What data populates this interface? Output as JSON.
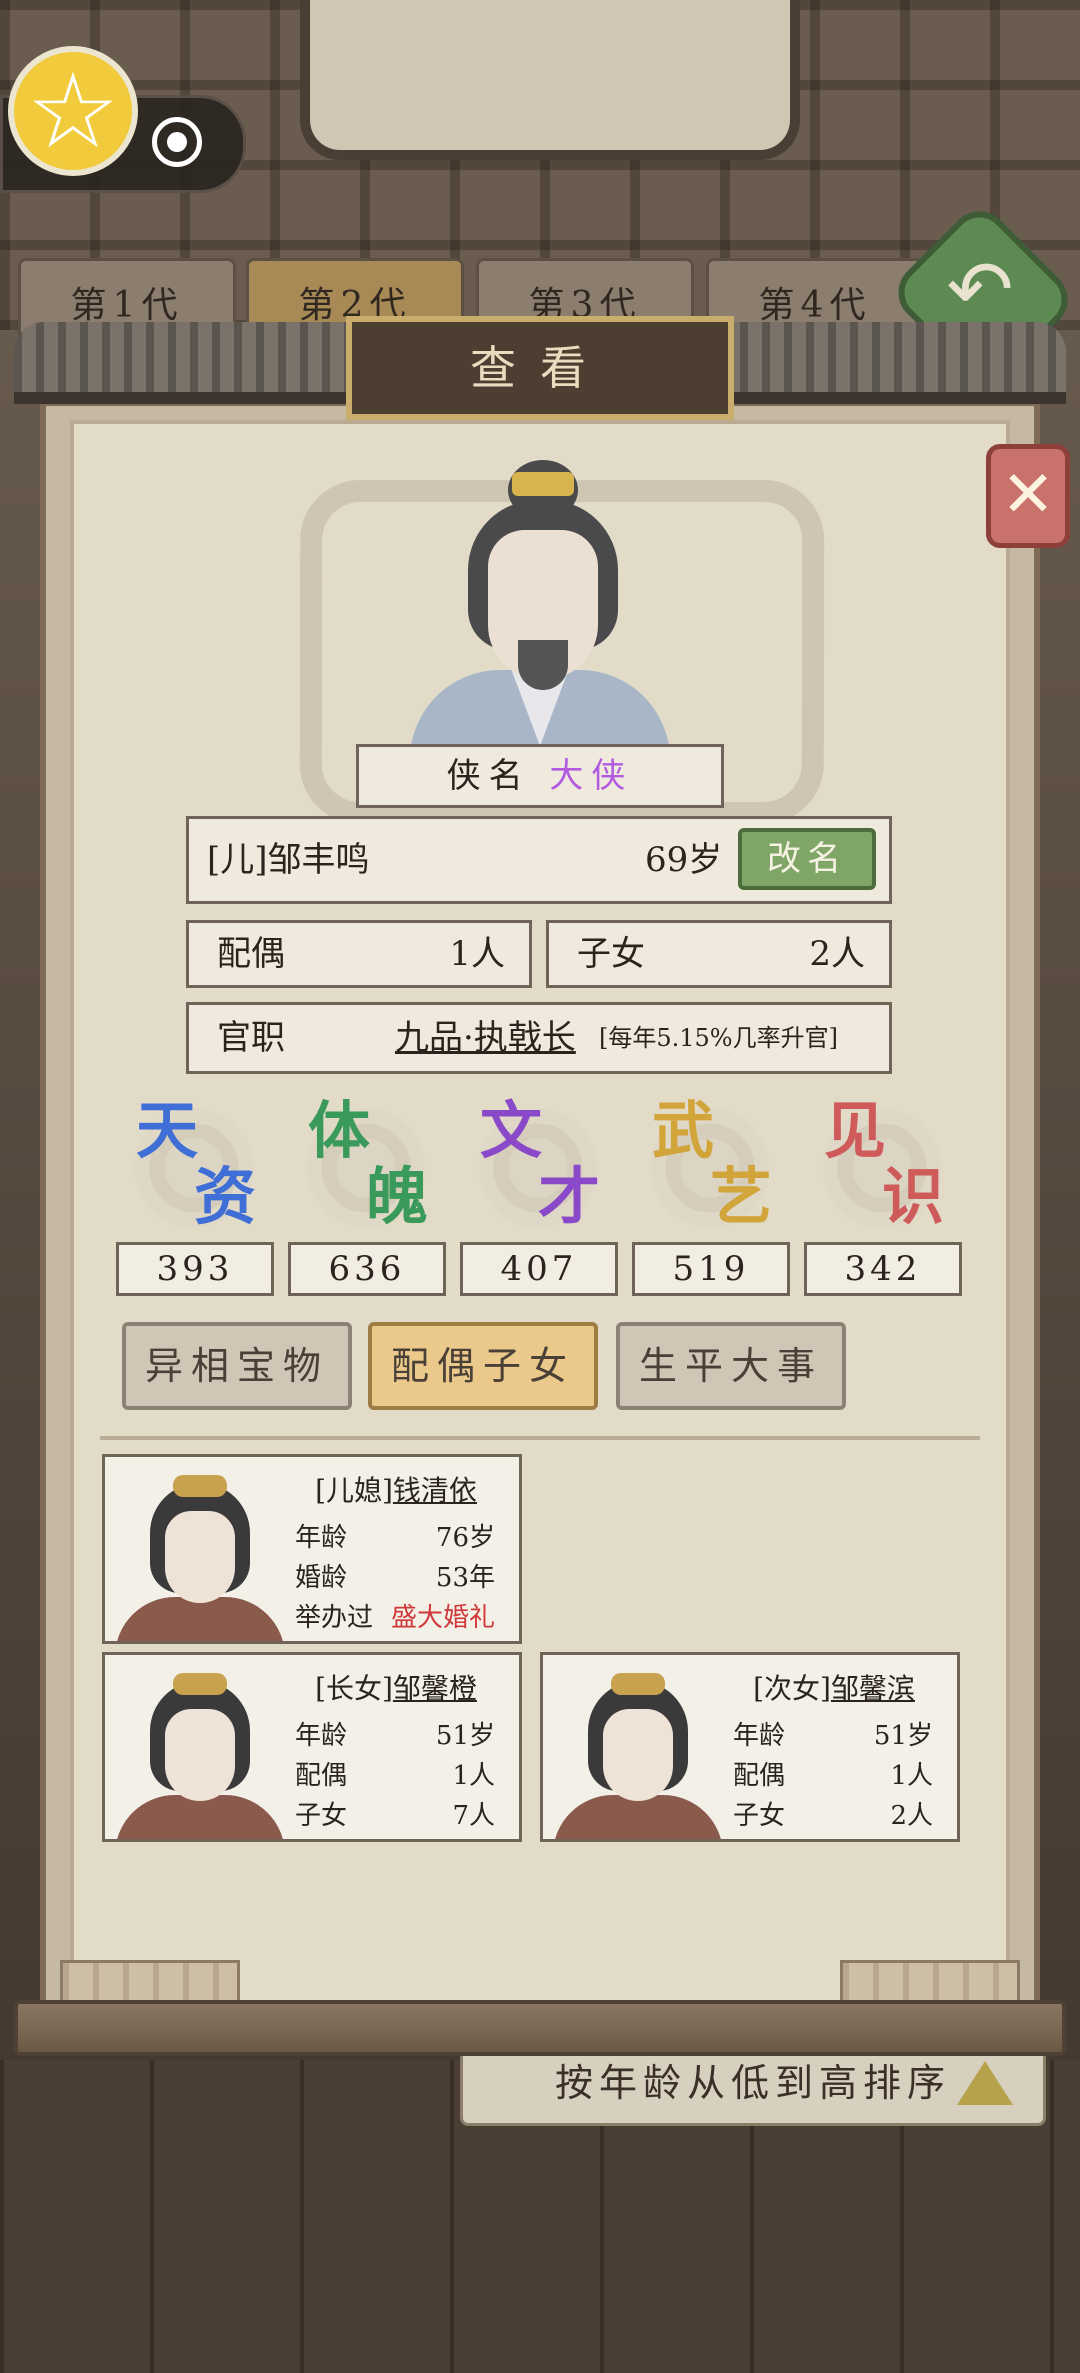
{
  "generation_tabs": [
    "第1代",
    "第2代",
    "第3代",
    "第4代"
  ],
  "panel_title": "查看",
  "hero": {
    "nickname_label": "侠名",
    "nickname_value": "大侠",
    "name": "[儿]邹丰鸣",
    "age": "69岁",
    "rename_button": "改名",
    "spouse_label": "配偶",
    "spouse_value": "1人",
    "children_label": "子女",
    "children_value": "2人",
    "office_label": "官职",
    "office_value": "九品·执戟长",
    "office_note": "[每年5.15%几率升官]"
  },
  "stats": [
    {
      "label_top": "天",
      "label_bottom": "资",
      "value": "393",
      "color": "#3f6fd6"
    },
    {
      "label_top": "体",
      "label_bottom": "魄",
      "value": "636",
      "color": "#3a9a5c"
    },
    {
      "label_top": "文",
      "label_bottom": "才",
      "value": "407",
      "color": "#8a49c9"
    },
    {
      "label_top": "武",
      "label_bottom": "艺",
      "value": "519",
      "color": "#d2a53a"
    },
    {
      "label_top": "见",
      "label_bottom": "识",
      "value": "342",
      "color": "#cf5a5a"
    }
  ],
  "sub_tabs": [
    "异相宝物",
    "配偶子女",
    "生平大事"
  ],
  "active_sub_tab": "配偶子女",
  "relatives": [
    {
      "title_prefix": "[儿媳]",
      "title_name": "钱清依",
      "row1_label": "年龄",
      "row1_value": "76岁",
      "row2_label": "婚龄",
      "row2_value": "53年",
      "row3_label": "举办过",
      "row3_value": "盛大婚礼"
    },
    {
      "title_prefix": "[长女]",
      "title_name": "邹馨橙",
      "row1_label": "年龄",
      "row1_value": "51岁",
      "row2_label": "配偶",
      "row2_value": "1人",
      "row3_label": "子女",
      "row3_value": "7人"
    },
    {
      "title_prefix": "[次女]",
      "title_name": "邹馨滨",
      "row1_label": "年龄",
      "row1_value": "51岁",
      "row2_label": "配偶",
      "row2_value": "1人",
      "row3_label": "子女",
      "row3_value": "2人"
    }
  ],
  "sort_label": "按年龄从低到高排序",
  "icons": {
    "badge": "star-icon",
    "record": "record-icon",
    "close": "close-icon",
    "back": "back-arrow-icon",
    "sort": "triangle-icon"
  }
}
